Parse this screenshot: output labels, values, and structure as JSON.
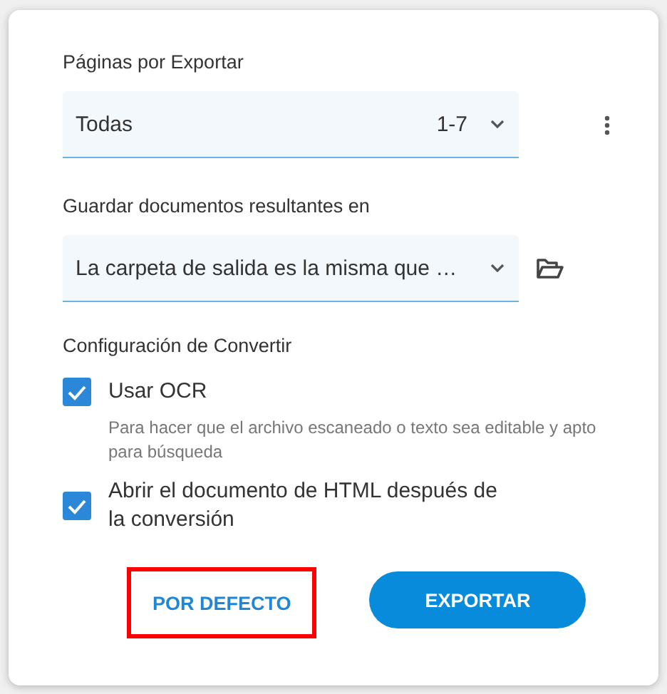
{
  "pages": {
    "label": "Páginas por Exportar",
    "value": "Todas",
    "range": "1-7"
  },
  "output": {
    "label": "Guardar documentos resultantes en",
    "value": "La carpeta de salida es la misma que …"
  },
  "convert": {
    "label": "Configuración de Convertir",
    "options": [
      {
        "label": "Usar OCR",
        "checked": true,
        "hint": "Para hacer que el archivo escaneado o texto sea editable y apto para búsqueda"
      },
      {
        "label": "Abrir el documento de HTML después de la conversión",
        "checked": true
      }
    ]
  },
  "buttons": [
    {
      "label": "POR DEFECTO",
      "kind": "text",
      "highlighted": true
    },
    {
      "label": "EXPORTAR",
      "kind": "primary",
      "highlighted": false
    }
  ]
}
